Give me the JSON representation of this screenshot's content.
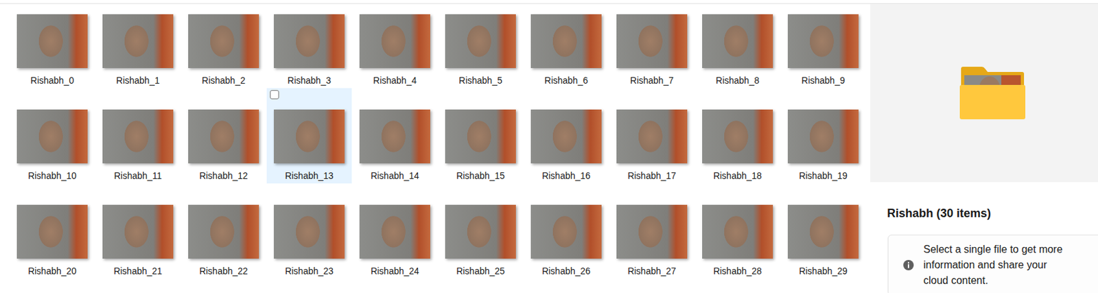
{
  "items": [
    {
      "name": "Rishabh_0",
      "selected": false,
      "checked": false
    },
    {
      "name": "Rishabh_1",
      "selected": false,
      "checked": false
    },
    {
      "name": "Rishabh_2",
      "selected": false,
      "checked": false
    },
    {
      "name": "Rishabh_3",
      "selected": false,
      "checked": false
    },
    {
      "name": "Rishabh_4",
      "selected": false,
      "checked": false
    },
    {
      "name": "Rishabh_5",
      "selected": false,
      "checked": false
    },
    {
      "name": "Rishabh_6",
      "selected": false,
      "checked": false
    },
    {
      "name": "Rishabh_7",
      "selected": false,
      "checked": false
    },
    {
      "name": "Rishabh_8",
      "selected": false,
      "checked": false
    },
    {
      "name": "Rishabh_9",
      "selected": false,
      "checked": false
    },
    {
      "name": "Rishabh_10",
      "selected": false,
      "checked": false
    },
    {
      "name": "Rishabh_11",
      "selected": false,
      "checked": false
    },
    {
      "name": "Rishabh_12",
      "selected": false,
      "checked": false
    },
    {
      "name": "Rishabh_13",
      "selected": true,
      "checked": false
    },
    {
      "name": "Rishabh_14",
      "selected": false,
      "checked": false
    },
    {
      "name": "Rishabh_15",
      "selected": false,
      "checked": false
    },
    {
      "name": "Rishabh_16",
      "selected": false,
      "checked": false
    },
    {
      "name": "Rishabh_17",
      "selected": false,
      "checked": false
    },
    {
      "name": "Rishabh_18",
      "selected": false,
      "checked": false
    },
    {
      "name": "Rishabh_19",
      "selected": false,
      "checked": false
    },
    {
      "name": "Rishabh_20",
      "selected": false,
      "checked": false
    },
    {
      "name": "Rishabh_21",
      "selected": false,
      "checked": false
    },
    {
      "name": "Rishabh_22",
      "selected": false,
      "checked": false
    },
    {
      "name": "Rishabh_23",
      "selected": false,
      "checked": false
    },
    {
      "name": "Rishabh_24",
      "selected": false,
      "checked": false
    },
    {
      "name": "Rishabh_25",
      "selected": false,
      "checked": false
    },
    {
      "name": "Rishabh_26",
      "selected": false,
      "checked": false
    },
    {
      "name": "Rishabh_27",
      "selected": false,
      "checked": false
    },
    {
      "name": "Rishabh_28",
      "selected": false,
      "checked": false
    },
    {
      "name": "Rishabh_29",
      "selected": false,
      "checked": false
    }
  ],
  "details": {
    "title": "Rishabh (30 items)",
    "info": "Select a single file to get more information and share your cloud content."
  }
}
